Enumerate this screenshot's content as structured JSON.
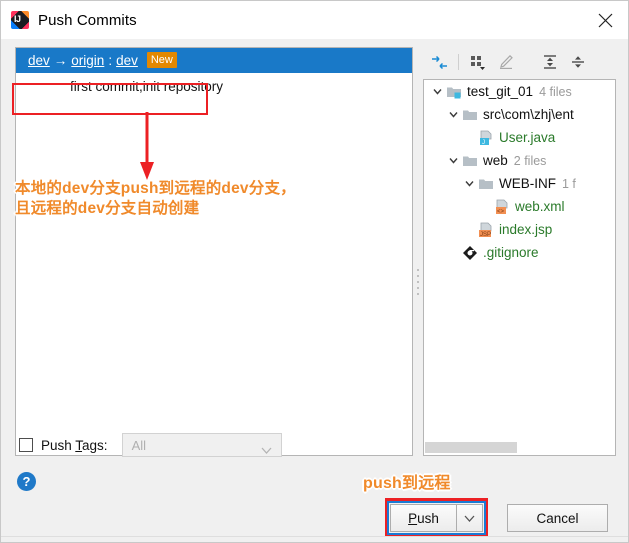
{
  "window": {
    "title": "Push Commits",
    "app_icon": "intellij-idea-icon",
    "close_label": "✕"
  },
  "commits_panel": {
    "branch_row": {
      "local_branch": "dev",
      "arrow": "→",
      "remote": "origin",
      "separator": ":",
      "remote_branch": "dev",
      "badge": "New",
      "selected": true,
      "selection_color": "#1979c8",
      "badge_color": "#e38800"
    },
    "commits": [
      {
        "message": "first commit,init repository"
      }
    ]
  },
  "annotations": {
    "branch_note_line1": "本地的dev分支push到远程的dev分支，",
    "branch_note_line2": "且远程的dev分支自动创建",
    "push_note": "push到远程",
    "highlight_color": "#ec2024",
    "text_color": "#f08a2b"
  },
  "tree_toolbar": {
    "buttons": [
      {
        "name": "show-diff-icon",
        "tooltip": "Show Diff"
      },
      {
        "name": "group-by-icon",
        "tooltip": "Group By"
      },
      {
        "name": "edit-source-icon",
        "tooltip": "Edit Source"
      },
      {
        "name": "expand-all-icon",
        "tooltip": "Expand All"
      },
      {
        "name": "collapse-all-icon",
        "tooltip": "Collapse All"
      }
    ]
  },
  "file_tree": {
    "nodes": [
      {
        "depth": 0,
        "expanded": true,
        "icon": "module-folder-icon",
        "label": "test_git_01",
        "count": "4 files",
        "color": "dark"
      },
      {
        "depth": 1,
        "expanded": true,
        "icon": "folder-icon",
        "label": "src\\com\\zhj\\ent",
        "count": "",
        "color": "dark"
      },
      {
        "depth": 2,
        "expanded": null,
        "icon": "java-file-icon",
        "label": "User.java",
        "count": "",
        "color": "green"
      },
      {
        "depth": 1,
        "expanded": true,
        "icon": "folder-icon",
        "label": "web",
        "count": "2 files",
        "color": "dark"
      },
      {
        "depth": 2,
        "expanded": true,
        "icon": "folder-icon",
        "label": "WEB-INF",
        "count": "1 f",
        "color": "dark"
      },
      {
        "depth": 3,
        "expanded": null,
        "icon": "xml-file-icon",
        "label": "web.xml",
        "count": "",
        "color": "green"
      },
      {
        "depth": 2,
        "expanded": null,
        "icon": "jsp-file-icon",
        "label": "index.jsp",
        "count": "",
        "color": "green"
      },
      {
        "depth": 1,
        "expanded": null,
        "icon": "gitignore-file-icon",
        "label": ".gitignore",
        "count": "",
        "color": "green"
      }
    ]
  },
  "options": {
    "push_tags_label_pre": "Push ",
    "push_tags_label_mnemonic": "T",
    "push_tags_label_post": "ags:",
    "push_tags_checked": false,
    "tags_select_value": "All",
    "tags_select_enabled": false
  },
  "footer": {
    "help_label": "?",
    "push_label_pre": "",
    "push_mnemonic": "P",
    "push_label_post": "ush",
    "push_dropdown_icon": "chevron-down-icon",
    "cancel_label": "Cancel"
  }
}
